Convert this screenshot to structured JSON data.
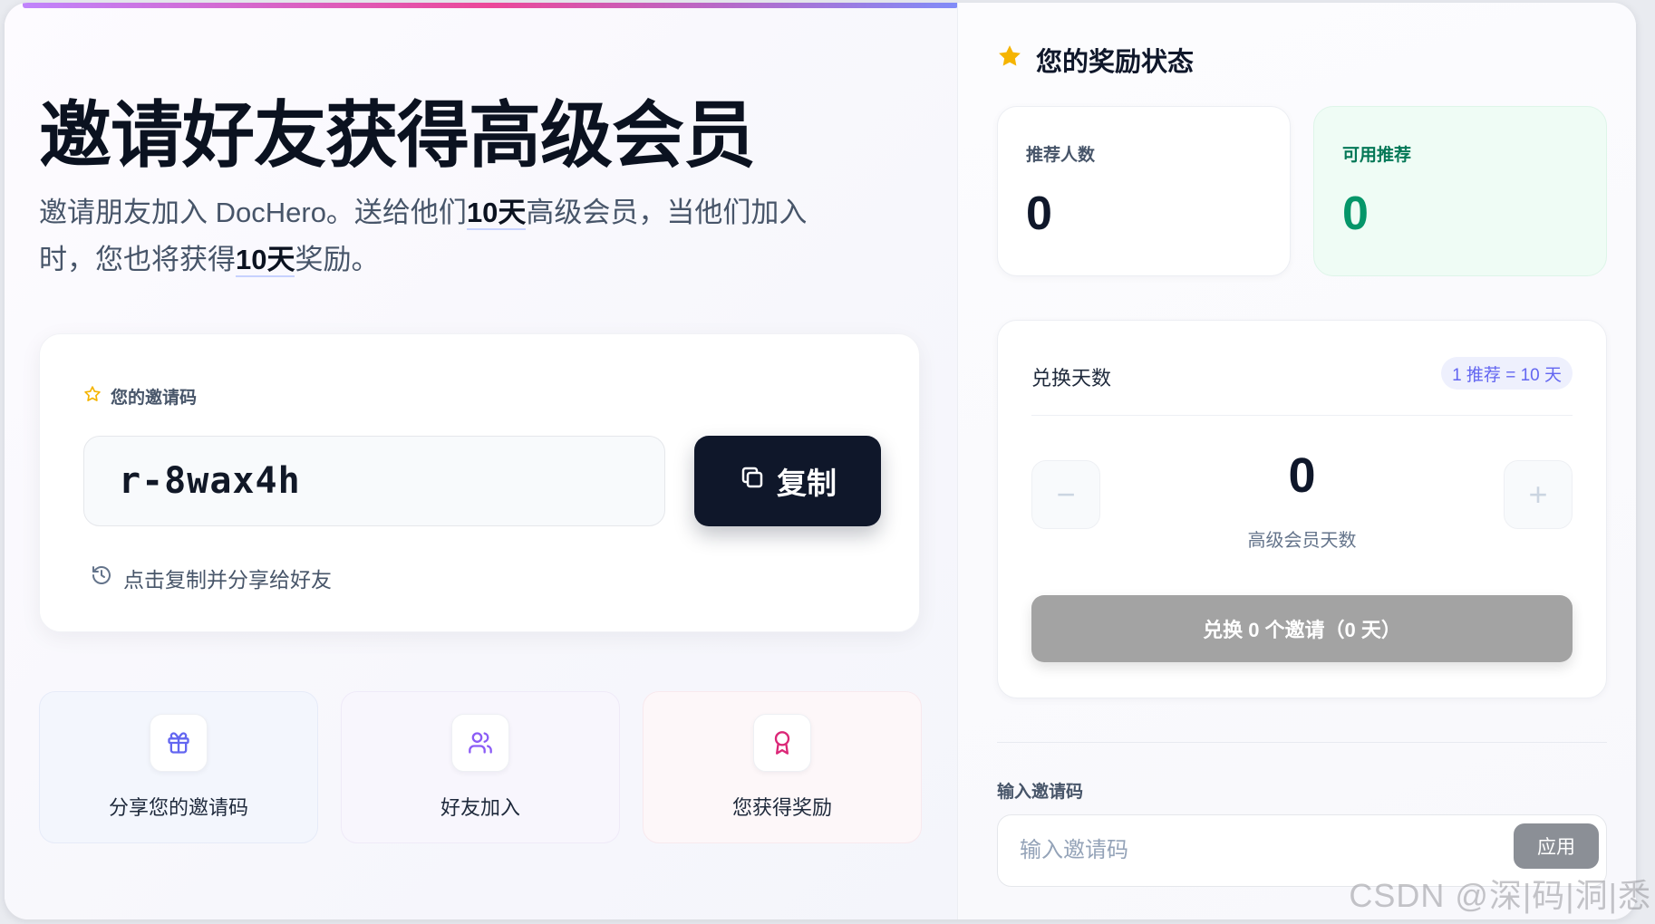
{
  "hero": {
    "title": "邀请好友获得高级会员",
    "desc_part1": "邀请朋友加入 DocHero。送给他们",
    "desc_bold1": "10天",
    "desc_part2": "高级会员，当他们加入时，您也将获得",
    "desc_bold2": "10天",
    "desc_part3": "奖励。"
  },
  "invite_code_card": {
    "label": "您的邀请码",
    "code": "r-8wax4h",
    "copy_label": "复制",
    "hint": "点击复制并分享给好友"
  },
  "steps": [
    {
      "label": "分享您的邀请码",
      "icon": "gift-icon"
    },
    {
      "label": "好友加入",
      "icon": "users-icon"
    },
    {
      "label": "您获得奖励",
      "icon": "award-icon"
    }
  ],
  "rewards": {
    "title": "您的奖励状态",
    "referrals_label": "推荐人数",
    "referrals_value": "0",
    "available_label": "可用推荐",
    "available_value": "0"
  },
  "redeem": {
    "title": "兑换天数",
    "rate": "1 推荐 = 10 天",
    "days_value": "0",
    "days_label": "高级会员天数",
    "minus": "−",
    "plus": "+",
    "button_label": "兑换 0 个邀请（0 天）"
  },
  "enter_code": {
    "label": "输入邀请码",
    "placeholder": "输入邀请码",
    "apply_label": "应用"
  },
  "watermark": "CSDN @深|码|洞|悉",
  "colors": {
    "dark_button": "#0f172a",
    "accent_green": "#059669",
    "accent_indigo": "#6366f1",
    "star": "#f5b400"
  }
}
